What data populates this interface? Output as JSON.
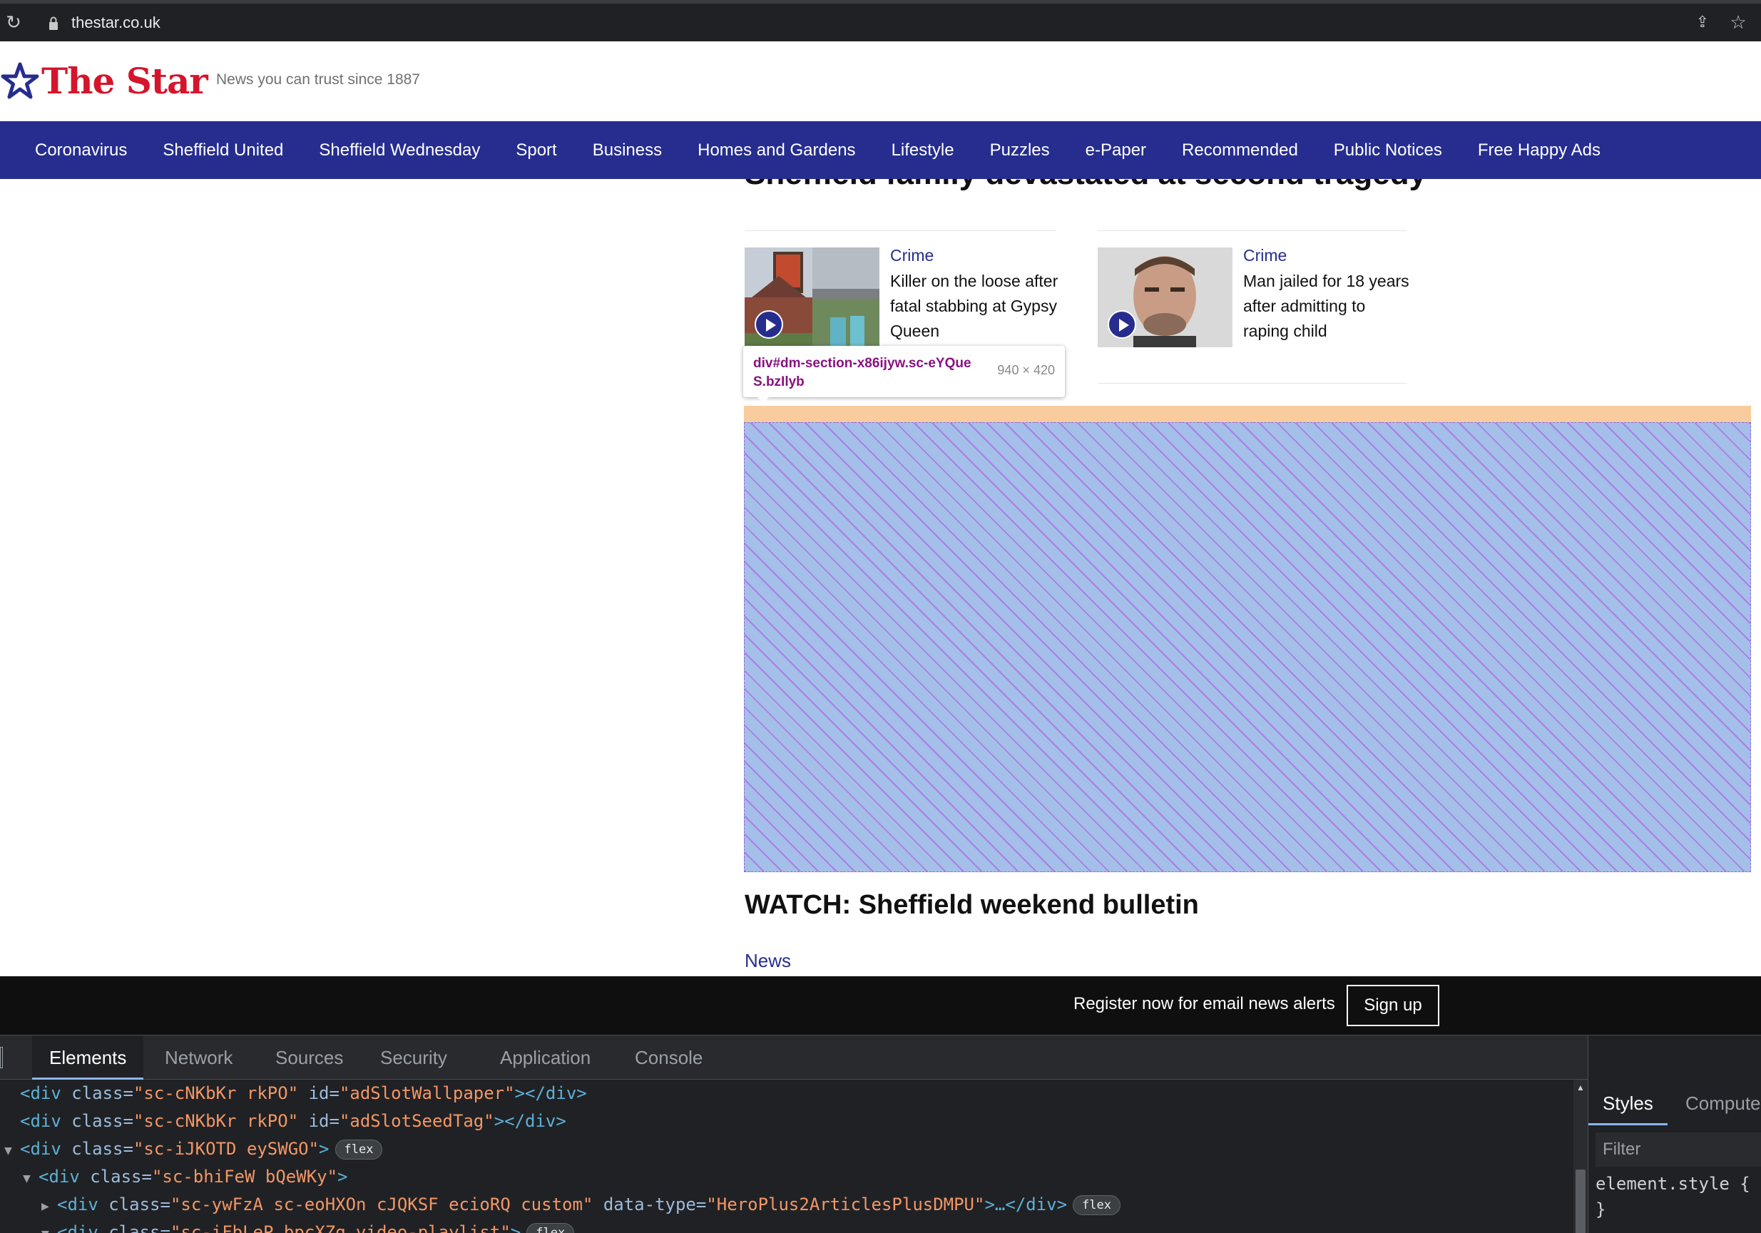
{
  "browser": {
    "url": "thestar.co.uk"
  },
  "site": {
    "logo_text": "The Star",
    "tagline": "News you can trust since 1887",
    "brand_red": "#d5152c",
    "brand_blue": "#262d8f"
  },
  "nav": {
    "items": [
      "Coronavirus",
      "Sheffield United",
      "Sheffield Wednesday",
      "Sport",
      "Business",
      "Homes and Gardens",
      "Lifestyle",
      "Puzzles",
      "e-Paper",
      "Recommended",
      "Public Notices",
      "Free Happy Ads"
    ]
  },
  "content": {
    "cut_headline": "Sheffield family devastated at second tragedy",
    "articles": [
      {
        "category": "Crime",
        "title": "Killer on the loose after fatal stabbing at Gypsy Queen"
      },
      {
        "category": "Crime",
        "title": "Man jailed for 18 years after admitting to raping child"
      }
    ],
    "tooltip": {
      "selector": "div#dm-section-x86ijyw.sc-eYQueS.bzIlyb",
      "size": "940 × 420"
    },
    "watch_heading": "WATCH: Sheffield weekend bulletin",
    "news_label": "News"
  },
  "register": {
    "text": "Register now for email news alerts",
    "button": "Sign up"
  },
  "devtools": {
    "tabs": [
      "Elements",
      "Network",
      "Sources",
      "Security",
      "Application",
      "Console"
    ],
    "active_tab": "Elements",
    "dom_lines": [
      {
        "open": "<div ",
        "a1": "class=",
        "v1": "\"sc-cNKbKr rkPO\"",
        "a2": " id=",
        "v2": "\"adSlotWallpaper\"",
        "close": "></div>"
      },
      {
        "open": "<div ",
        "a1": "class=",
        "v1": "\"sc-cNKbKr rkPO\"",
        "a2": " id=",
        "v2": "\"adSlotSeedTag\"",
        "close": "></div>"
      },
      {
        "open": "<div ",
        "a1": "class=",
        "v1": "\"sc-iJKOTD eySWGO\"",
        "close": ">",
        "badge": "flex"
      },
      {
        "open": "<div ",
        "a1": "class=",
        "v1": "\"sc-bhiFeW bQeWKy\"",
        "close": ">"
      },
      {
        "open": "<div ",
        "a1": "class=",
        "v1": "\"sc-ywFzA sc-eoHXOn cJQKSF ecioRQ custom\"",
        "a2": " data-type=",
        "v2": "\"HeroPlus2ArticlesPlusDMPU\"",
        "close": ">…</div>",
        "badge": "flex"
      },
      {
        "open": "<div ",
        "a1": "class=",
        "v1": "\"sc-iFbLeP bpcXZq video-playlist\"",
        "close": ">",
        "badge": "flex"
      }
    ],
    "styles": {
      "tabs": [
        "Styles",
        "Computed"
      ],
      "filter_placeholder": "Filter",
      "element_style": "element.style {",
      "close_brace": "}"
    }
  }
}
